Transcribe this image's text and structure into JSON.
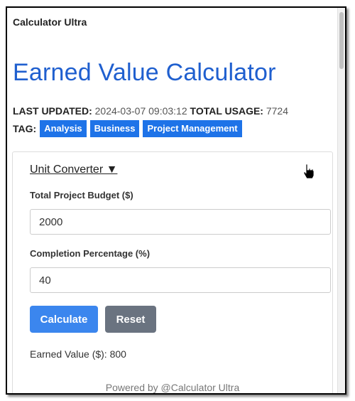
{
  "window": {
    "app_title": "Calculator Ultra"
  },
  "page": {
    "title": "Earned Value Calculator",
    "last_updated_label": "LAST UPDATED:",
    "last_updated_value": "2024-03-07 09:03:12",
    "total_usage_label": "TOTAL USAGE:",
    "total_usage_value": "7724",
    "tag_label": "TAG:",
    "tags": [
      "Analysis",
      "Business",
      "Project Management"
    ]
  },
  "calculator": {
    "unit_converter_label": "Unit Converter ▼",
    "budget_label": "Total Project Budget ($)",
    "budget_value": "2000",
    "completion_label": "Completion Percentage (%)",
    "completion_value": "40",
    "calculate_label": "Calculate",
    "reset_label": "Reset",
    "result_text": "Earned Value ($): 800"
  },
  "footer": {
    "text": "Powered by @Calculator Ultra"
  },
  "colors": {
    "accent": "#1f5fcf",
    "tag_bg": "#1e73e8",
    "calc_btn": "#3b86ee",
    "reset_btn": "#6a7380"
  },
  "icons": {
    "cursor": "hand-pointer-icon"
  }
}
